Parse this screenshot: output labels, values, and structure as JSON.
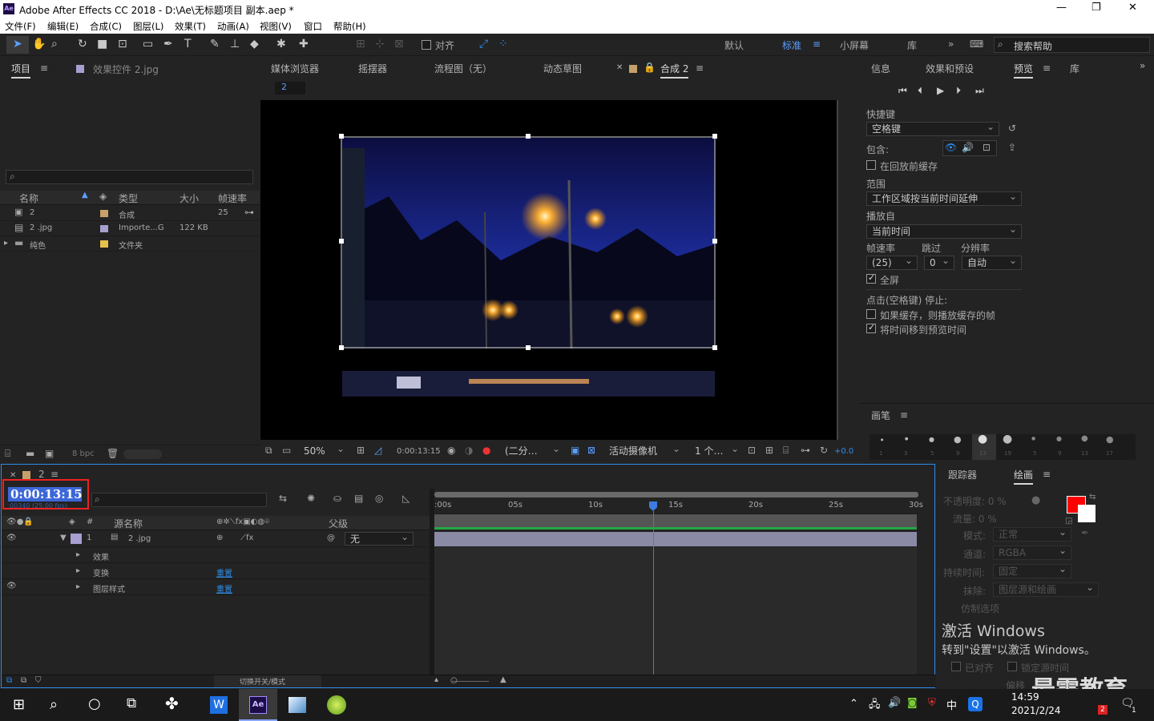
{
  "app": {
    "title": "Adobe After Effects CC 2018 - D:\\Ae\\无标题项目 副本.aep *",
    "icon_text": "Ae"
  },
  "menu": [
    "文件(F)",
    "编辑(E)",
    "合成(C)",
    "图层(L)",
    "效果(T)",
    "动画(A)",
    "视图(V)",
    "窗口",
    "帮助(H)"
  ],
  "toolbar": {
    "align_label": "对齐",
    "workspaces": [
      "默认",
      "标准",
      "小屏幕",
      "库"
    ],
    "active_workspace": "标准",
    "search_placeholder": "搜索帮助"
  },
  "project": {
    "tab_label": "项目",
    "effects_tab": "效果控件 2.jpg",
    "columns": [
      "名称",
      "类型",
      "大小",
      "帧速率"
    ],
    "items": [
      {
        "name": "2",
        "type": "合成",
        "size": "",
        "fps": "25",
        "color": "#c5a06b"
      },
      {
        "name": "2 .jpg",
        "type": "Importe...G",
        "size": "122 KB",
        "fps": "",
        "color": "#a99ed0"
      },
      {
        "name": "纯色",
        "type": "文件夹",
        "size": "",
        "fps": "",
        "color": "#e6c14a"
      }
    ],
    "bpc": "8 bpc"
  },
  "viewer": {
    "tabs": [
      "媒体浏览器",
      "摇摆器",
      "流程图（无）",
      "动态草图",
      "合成 2"
    ],
    "comp_chip": "2",
    "zoom": "50%",
    "timecode": "0:00:13:15",
    "resolution": "(二分…",
    "camera": "活动摄像机",
    "views": "1 个…",
    "exposure": "+0.0"
  },
  "preview": {
    "tabs": [
      "信息",
      "效果和预设",
      "预览",
      "库"
    ],
    "shortcut_label": "快捷键",
    "shortcut_value": "空格键",
    "include_label": "包含:",
    "cache_before": "在回放前缓存",
    "range_label": "范围",
    "range_value": "工作区域按当前时间延伸",
    "play_from_label": "播放自",
    "play_from_value": "当前时间",
    "fps_label": "帧速率",
    "skip_label": "跳过",
    "res_label": "分辨率",
    "fps_value": "(25)",
    "skip_value": "0",
    "res_value": "自动",
    "fullscreen": "全屏",
    "stop_label": "点击(空格键) 停止:",
    "stop_opt1": "如果缓存，则播放缓存的帧",
    "stop_opt2": "将时间移到预览时间"
  },
  "brush": {
    "title": "画笔",
    "sizes": [
      "1",
      "3",
      "5",
      "9",
      "13",
      "19",
      "5",
      "9",
      "13",
      "17"
    ]
  },
  "timeline": {
    "tab": "2",
    "current_time": "0:00:13:15",
    "sub_time": "00340 (25.00 fps)",
    "col_num": "#",
    "col_source": "源名称",
    "col_parent": "父级",
    "layer_num": "1",
    "layer_name": "2 .jpg",
    "parent_value": "无",
    "props": [
      "效果",
      "变换",
      "图层样式"
    ],
    "reset": "重置",
    "ruler": [
      ":00s",
      "05s",
      "10s",
      "15s",
      "20s",
      "25s",
      "30s"
    ],
    "toggle_label": "切换开关/模式"
  },
  "tracker": {
    "tab1": "跟踪器",
    "tab2": "绘画",
    "opacity": "不透明度: 0 %",
    "flow": "流量: 0 %",
    "mode_label": "模式:",
    "mode_value": "正常",
    "channel_label": "通道:",
    "channel_value": "RGBA",
    "duration_label": "持续时间:",
    "duration_value": "固定",
    "erase_label": "抹除:",
    "erase_value": "图层源和绘画",
    "clone_label": "仿制选项",
    "aligned": "已对齐",
    "lock_time": "锁定源时间",
    "offset": "偏移"
  },
  "watermark": {
    "line1": "激活 Windows",
    "line2": "转到\"设置\"以激活 Windows。",
    "brand": "最需教育"
  },
  "clock": {
    "time": "14:59",
    "date": "2021/2/24",
    "badge": "2",
    "notif": "1",
    "ime": "中"
  }
}
